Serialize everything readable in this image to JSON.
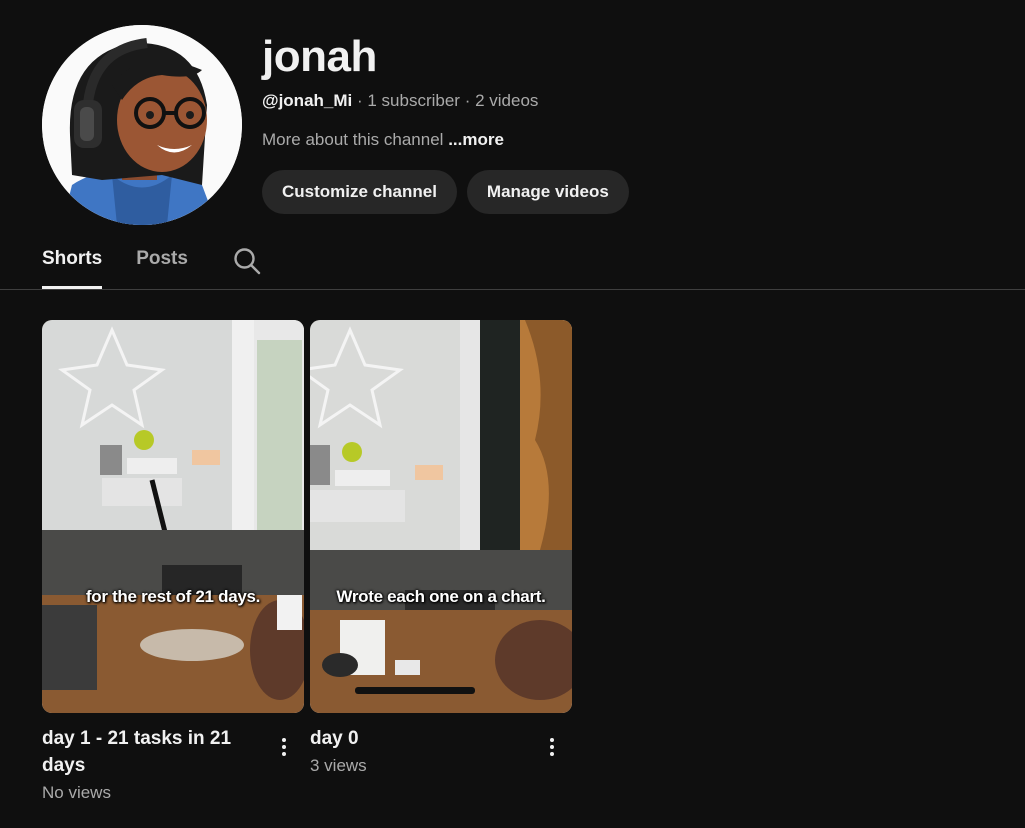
{
  "channel": {
    "name": "jonah",
    "handle": "@jonah_Mi",
    "subscribers": "1 subscriber",
    "videos": "2 videos",
    "separator": " · ",
    "description": "More about this channel",
    "more_label": "...more"
  },
  "buttons": {
    "customize": "Customize channel",
    "manage": "Manage videos"
  },
  "tabs": [
    {
      "label": "Shorts",
      "active": true
    },
    {
      "label": "Posts",
      "active": false
    }
  ],
  "icons": {
    "search": "search-icon",
    "more": "kebab-menu-icon"
  },
  "shorts": [
    {
      "title": "day 1 - 21 tasks in 21 days",
      "views": "No views",
      "caption": "for the rest of 21 days."
    },
    {
      "title": "day 0",
      "views": "3 views",
      "caption": "Wrote each one on a chart."
    }
  ],
  "colors": {
    "background": "#0f0f0f",
    "button_bg": "#272727",
    "text_primary": "#f1f1f1",
    "text_secondary": "#aaaaaa"
  }
}
